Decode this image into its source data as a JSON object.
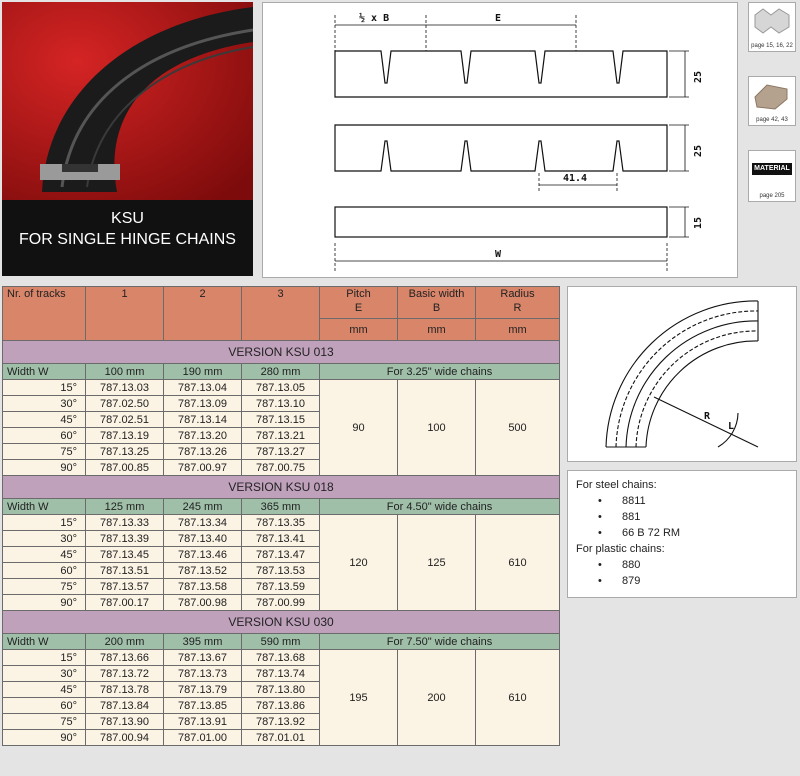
{
  "product": {
    "code": "KSU",
    "subtitle": "FOR SINGLE HINGE CHAINS"
  },
  "drawing": {
    "half_pitch": "½ x B",
    "pitch": "E",
    "h1": "25",
    "h2": "25",
    "gap": "41.4",
    "h3": "15",
    "width": "W",
    "radius_r": "R",
    "radius_l": "L"
  },
  "thumbs": [
    {
      "icon": "chain-link-icon",
      "caption": "page 15, 16, 22"
    },
    {
      "icon": "plastic-chain-icon",
      "caption": "page 42, 43"
    },
    {
      "icon": "material-label-icon",
      "label": "MATERIAL",
      "caption": "page 205"
    }
  ],
  "table": {
    "head": {
      "tracks": "Nr. of tracks",
      "c1": "1",
      "c2": "2",
      "c3": "3",
      "pitch": "Pitch",
      "pitch_sym": "E",
      "width": "Basic width",
      "width_sym": "B",
      "radius": "Radius",
      "radius_sym": "R",
      "unit": "mm"
    },
    "versions": [
      {
        "title": "VERSION KSU 013",
        "label": "Width W",
        "w1": "100 mm",
        "w2": "190 mm",
        "w3": "280 mm",
        "for": "For 3.25\" wide chains",
        "pitch": "90",
        "width": "100",
        "radius": "500",
        "rows": [
          [
            "15°",
            "787.13.03",
            "787.13.04",
            "787.13.05"
          ],
          [
            "30°",
            "787.02.50",
            "787.13.09",
            "787.13.10"
          ],
          [
            "45°",
            "787.02.51",
            "787.13.14",
            "787.13.15"
          ],
          [
            "60°",
            "787.13.19",
            "787.13.20",
            "787.13.21"
          ],
          [
            "75°",
            "787.13.25",
            "787.13.26",
            "787.13.27"
          ],
          [
            "90°",
            "787.00.85",
            "787.00.97",
            "787.00.75"
          ]
        ]
      },
      {
        "title": "VERSION KSU 018",
        "label": "Width W",
        "w1": "125 mm",
        "w2": "245 mm",
        "w3": "365 mm",
        "for": "For 4.50\" wide chains",
        "pitch": "120",
        "width": "125",
        "radius": "610",
        "rows": [
          [
            "15°",
            "787.13.33",
            "787.13.34",
            "787.13.35"
          ],
          [
            "30°",
            "787.13.39",
            "787.13.40",
            "787.13.41"
          ],
          [
            "45°",
            "787.13.45",
            "787.13.46",
            "787.13.47"
          ],
          [
            "60°",
            "787.13.51",
            "787.13.52",
            "787.13.53"
          ],
          [
            "75°",
            "787.13.57",
            "787.13.58",
            "787.13.59"
          ],
          [
            "90°",
            "787.00.17",
            "787.00.98",
            "787.00.99"
          ]
        ]
      },
      {
        "title": "VERSION KSU 030",
        "label": "Width W",
        "w1": "200 mm",
        "w2": "395 mm",
        "w3": "590 mm",
        "for": "For 7.50\" wide chains",
        "pitch": "195",
        "width": "200",
        "radius": "610",
        "rows": [
          [
            "15°",
            "787.13.66",
            "787.13.67",
            "787.13.68"
          ],
          [
            "30°",
            "787.13.72",
            "787.13.73",
            "787.13.74"
          ],
          [
            "45°",
            "787.13.78",
            "787.13.79",
            "787.13.80"
          ],
          [
            "60°",
            "787.13.84",
            "787.13.85",
            "787.13.86"
          ],
          [
            "75°",
            "787.13.90",
            "787.13.91",
            "787.13.92"
          ],
          [
            "90°",
            "787.00.94",
            "787.01.00",
            "787.01.01"
          ]
        ]
      }
    ]
  },
  "chains": {
    "steel_title": "For steel chains:",
    "steel": [
      "8811",
      "881",
      "66 B 72 RM"
    ],
    "plastic_title": "For plastic chains:",
    "plastic": [
      "880",
      "879"
    ],
    "bullet": "•"
  }
}
